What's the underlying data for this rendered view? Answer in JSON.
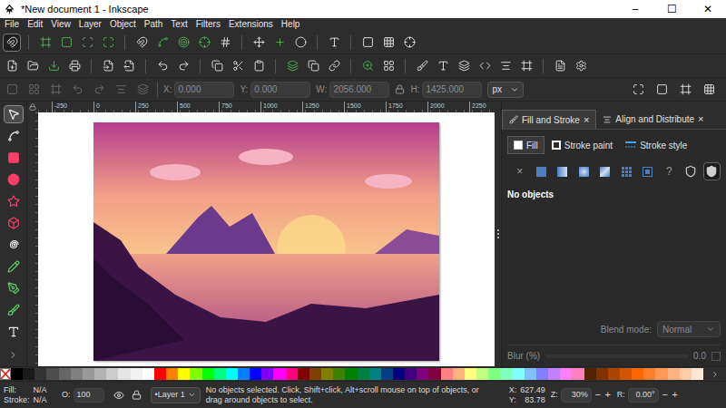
{
  "window": {
    "title": "*New document 1 - Inkscape",
    "controls": [
      "–",
      "☐",
      "✕"
    ]
  },
  "menu": [
    "File",
    "Edit",
    "View",
    "Layer",
    "Object",
    "Path",
    "Text",
    "Filters",
    "Extensions",
    "Help"
  ],
  "tool_controls": {
    "fields": [
      {
        "label": "X:",
        "value": "0.000",
        "disabled": true
      },
      {
        "label": "Y:",
        "value": "0.000",
        "disabled": true
      },
      {
        "label": "W:",
        "value": "2056.000",
        "disabled": true
      },
      {
        "label": "H:",
        "value": "1425.000",
        "disabled": true
      }
    ],
    "unit": "px"
  },
  "tools": [
    {
      "kind": "selector",
      "selected": true
    },
    {
      "kind": "node",
      "selected": false
    },
    {
      "kind": "rect",
      "selected": false
    },
    {
      "kind": "ellipse",
      "selected": false
    },
    {
      "kind": "star",
      "selected": false
    },
    {
      "kind": "box3d",
      "selected": false
    },
    {
      "kind": "spiral",
      "selected": false
    },
    {
      "kind": "pencil",
      "selected": false
    },
    {
      "kind": "pen",
      "selected": false
    },
    {
      "kind": "calligraphy",
      "selected": false
    },
    {
      "kind": "text",
      "selected": false
    }
  ],
  "ruler": {
    "top": [
      "-250",
      "0",
      "250",
      "500",
      "750",
      "1000",
      "1250",
      "1500",
      "1750",
      "2000",
      "2250"
    ]
  },
  "dock": {
    "tabs": [
      {
        "label": "Fill and Stroke",
        "close": "×",
        "selected": true
      },
      {
        "label": "Align and Distribute",
        "close": "×",
        "selected": false
      }
    ],
    "subtabs": [
      {
        "label": "Fill",
        "selected": true
      },
      {
        "label": "Stroke paint",
        "selected": false
      },
      {
        "label": "Stroke style",
        "selected": false
      }
    ],
    "paint_buttons": [
      {
        "kind": "glyph",
        "text": "×",
        "selected": false
      },
      {
        "kind": "flat",
        "selected": false
      },
      {
        "kind": "linear",
        "selected": false
      },
      {
        "kind": "radial",
        "selected": false
      },
      {
        "kind": "mesh",
        "selected": false
      },
      {
        "kind": "pattern",
        "selected": false
      },
      {
        "kind": "swatch",
        "selected": false
      },
      {
        "kind": "glyph",
        "text": "?",
        "selected": false
      },
      {
        "kind": "evenodd",
        "selected": false
      },
      {
        "kind": "nonzero",
        "selected": true
      }
    ],
    "message": "No objects",
    "blend": {
      "label": "Blend mode:",
      "value": "Normal"
    },
    "blur": {
      "label": "Blur (%)",
      "value": "0.0"
    }
  },
  "palette": [
    {
      "kind": "none"
    },
    {
      "kind": "swatch",
      "color": "#000000"
    },
    {
      "kind": "swatch",
      "color": "#1a1a1a"
    },
    {
      "kind": "swatch",
      "color": "#333333"
    },
    {
      "kind": "swatch",
      "color": "#4d4d4d"
    },
    {
      "kind": "swatch",
      "color": "#666666"
    },
    {
      "kind": "swatch",
      "color": "#808080"
    },
    {
      "kind": "swatch",
      "color": "#999999"
    },
    {
      "kind": "swatch",
      "color": "#b3b3b3"
    },
    {
      "kind": "swatch",
      "color": "#cccccc"
    },
    {
      "kind": "swatch",
      "color": "#e6e6e6"
    },
    {
      "kind": "swatch",
      "color": "#f2f2f2"
    },
    {
      "kind": "swatch",
      "color": "#ffffff"
    },
    {
      "kind": "swatch",
      "color": "#ff0000"
    },
    {
      "kind": "swatch",
      "color": "#ff8000"
    },
    {
      "kind": "swatch",
      "color": "#ffff00"
    },
    {
      "kind": "swatch",
      "color": "#80ff00"
    },
    {
      "kind": "swatch",
      "color": "#00ff00"
    },
    {
      "kind": "swatch",
      "color": "#00ff80"
    },
    {
      "kind": "swatch",
      "color": "#00ffff"
    },
    {
      "kind": "swatch",
      "color": "#0080ff"
    },
    {
      "kind": "swatch",
      "color": "#0000ff"
    },
    {
      "kind": "swatch",
      "color": "#8000ff"
    },
    {
      "kind": "swatch",
      "color": "#ff00ff"
    },
    {
      "kind": "swatch",
      "color": "#ff0080"
    },
    {
      "kind": "swatch",
      "color": "#800000"
    },
    {
      "kind": "swatch",
      "color": "#804000"
    },
    {
      "kind": "swatch",
      "color": "#808000"
    },
    {
      "kind": "swatch",
      "color": "#408000"
    },
    {
      "kind": "swatch",
      "color": "#008000"
    },
    {
      "kind": "swatch",
      "color": "#008040"
    },
    {
      "kind": "swatch",
      "color": "#008080"
    },
    {
      "kind": "swatch",
      "color": "#004080"
    },
    {
      "kind": "swatch",
      "color": "#000080"
    },
    {
      "kind": "swatch",
      "color": "#400080"
    },
    {
      "kind": "swatch",
      "color": "#800080"
    },
    {
      "kind": "swatch",
      "color": "#800040"
    },
    {
      "kind": "swatch",
      "color": "#ff8080"
    },
    {
      "kind": "swatch",
      "color": "#ffb380"
    },
    {
      "kind": "swatch",
      "color": "#ffff80"
    },
    {
      "kind": "swatch",
      "color": "#c0ff80"
    },
    {
      "kind": "swatch",
      "color": "#80ff80"
    },
    {
      "kind": "swatch",
      "color": "#80ffc0"
    },
    {
      "kind": "swatch",
      "color": "#80ffff"
    },
    {
      "kind": "swatch",
      "color": "#80c0ff"
    },
    {
      "kind": "swatch",
      "color": "#8080ff"
    },
    {
      "kind": "swatch",
      "color": "#c080ff"
    },
    {
      "kind": "swatch",
      "color": "#ff80ff"
    },
    {
      "kind": "swatch",
      "color": "#ff80c0"
    },
    {
      "kind": "swatch",
      "color": "#552200"
    },
    {
      "kind": "swatch",
      "color": "#803300"
    },
    {
      "kind": "swatch",
      "color": "#aa4400"
    },
    {
      "kind": "swatch",
      "color": "#d45500"
    },
    {
      "kind": "swatch",
      "color": "#ff6600"
    },
    {
      "kind": "swatch",
      "color": "#ff7f2a"
    },
    {
      "kind": "swatch",
      "color": "#ff9955"
    },
    {
      "kind": "swatch",
      "color": "#ffb380"
    },
    {
      "kind": "swatch",
      "color": "#ffccaa"
    },
    {
      "kind": "swatch",
      "color": "#ffe6d5"
    }
  ],
  "status_bar": {
    "fill": {
      "label": "Fill:",
      "value": "N/A"
    },
    "stroke": {
      "label": "Stroke:",
      "value": "N/A"
    },
    "opacity": {
      "label": "O:",
      "value": "100"
    },
    "layer": "•Layer 1",
    "message": "No objects selected. Click, Shift+click, Alt+scroll mouse on top of objects, or drag around objects to select.",
    "cursor": {
      "x_label": "X:",
      "x": "627.49",
      "y_label": "Y:",
      "y": "83.78"
    },
    "zoom": {
      "label": "Z:",
      "value": "30%"
    },
    "rotate": {
      "label": "R:",
      "value": "0.00°"
    },
    "steppers": [
      "−",
      "+"
    ]
  }
}
